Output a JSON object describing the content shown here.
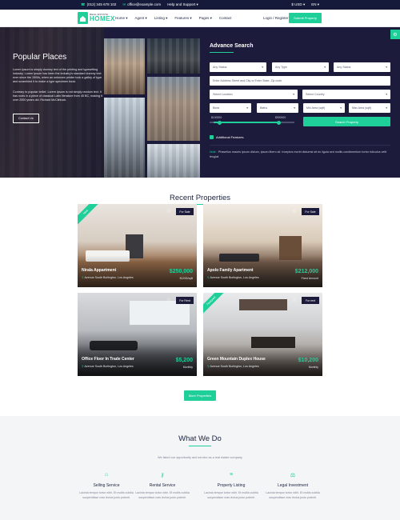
{
  "topbar": {
    "phone": "(012) 345 678 102",
    "email": "office@example.com",
    "help": "Help and Support",
    "currency": "$ USD",
    "language": "EN"
  },
  "navbar": {
    "logo_small": "REAL ESTATE",
    "logo_big": "HOMEX",
    "links": [
      "Home",
      "Agent",
      "Listing",
      "Features",
      "Pages",
      "Contact"
    ],
    "login": "Login / Register",
    "submit": "Submit Property"
  },
  "hero": {
    "title": "Popular Places",
    "paragraph1": "Lorem Ipsum is simply dummy text of the printing and typesetting industry. Lorem Ipsum has been the industry's standard dummy text ever since the 1500s, when an unknown printer took a galley of type and scrambled it to make a type specimen book.",
    "paragraph2": "Contrary to popular belief, Lorem Ipsum is not simply random text. It has roots in a piece of classical Latin literature from 45 BC, making it over 2000 years old. Richard McClintock.",
    "contact_button": "Contact Us"
  },
  "search": {
    "title": "Advance Search",
    "status1": "Any Status",
    "type": "Any Type",
    "status2": "Any Status",
    "address_placeholder": "Enter Address Street and City or Enter State, Zip code",
    "location": "Select Location",
    "country": "Select Country",
    "beds": "Beds",
    "baths": "Baths",
    "min_area": "Min Area (sqft)",
    "max_area": "Max Area (sqft)",
    "price_min": "$100000",
    "price_max": "$900000",
    "search_button": "Search Property",
    "additional": "Additional Features",
    "note_label": "Note :",
    "note": "Phasellus mauris ipsum dictum, ipsum libero sit. Inceptos morbi dictumst sit eu ligula sed mollis condimentum tortor ridiculus velit feugiat."
  },
  "recent": {
    "title": "Recent Properties",
    "cards": [
      {
        "name": "Nirala Appartment",
        "address": "Avenue South Burlington, Los Angeles",
        "price": "$250,000",
        "period": "$1200/sqft",
        "tag": "For Sale",
        "ribbon": "New"
      },
      {
        "name": "Apolo Family Apartment",
        "address": "Avenue South Burlington, Los Angeles",
        "price": "$212,000",
        "period": "Fixed Amount",
        "tag": "For Sale",
        "ribbon": ""
      },
      {
        "name": "Office Floor In Trade Center",
        "address": "Avenue South Burlington, Los Angeles",
        "price": "$5,200",
        "period": "Monthly",
        "tag": "For Rent",
        "ribbon": ""
      },
      {
        "name": "Green Mountain Duplex House",
        "address": "Avenue South Burlington, Los Angeles",
        "price": "$10,200",
        "period": "Monthly",
        "tag": "For rent",
        "ribbon": "Featured"
      }
    ],
    "more_button": "More Properties"
  },
  "what_we_do": {
    "title": "What We Do",
    "subtitle": "We listed our opportunity and service as a real estate company",
    "services": [
      {
        "title": "Selling Service",
        "desc": "Lacinia tempor tortor nibh. Et mollis cubilia suspendisse cras lectus justo potenti.",
        "icon": "house-icon"
      },
      {
        "title": "Rental Service",
        "desc": "Lacinia tempor tortor nibh. Et mollis cubilia suspendisse cras lectus justo potenti.",
        "icon": "key-icon"
      },
      {
        "title": "Property Listing",
        "desc": "Lacinia tempor tortor nibh. Et mollis cubilia suspendisse cras lectus justo potenti.",
        "icon": "list-icon"
      },
      {
        "title": "Legal Investment",
        "desc": "Lacinia tempor tortor nibh. Et mollis cubilia suspendisse cras lectus justo potenti.",
        "icon": "scale-icon"
      }
    ]
  },
  "colors": {
    "accent": "#1fcf9a",
    "dark": "#1d1b3c",
    "topbar": "#151a3a"
  }
}
